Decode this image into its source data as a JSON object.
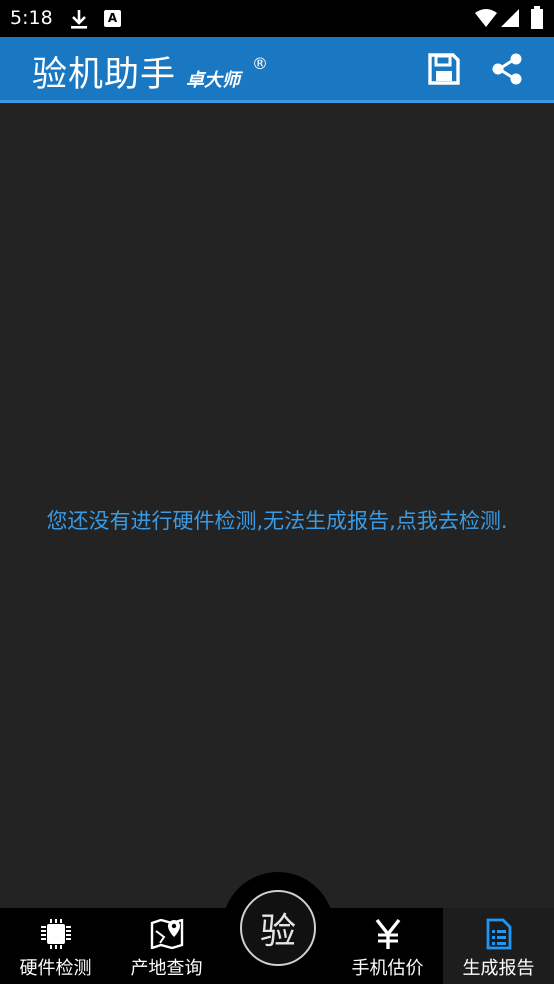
{
  "status_bar": {
    "time": "5:18",
    "download_icon": "download-icon",
    "notification_badge": "A"
  },
  "app_bar": {
    "title": "验机助手",
    "subtitle": "卓大师",
    "registered_mark": "®",
    "save_icon": "save-icon",
    "share_icon": "share-icon",
    "color": "#1a78c2"
  },
  "main": {
    "empty_message": "您还没有进行硬件检测,无法生成报告,点我去检测.",
    "message_color": "#3a9be4"
  },
  "bottom_nav": {
    "items": [
      {
        "label": "硬件检测",
        "icon": "chip-icon",
        "active": false
      },
      {
        "label": "产地查询",
        "icon": "map-pin-icon",
        "active": false
      },
      {
        "label": "手机估价",
        "icon": "yen-icon",
        "active": false
      },
      {
        "label": "生成报告",
        "icon": "report-icon",
        "active": true
      }
    ],
    "center_button": {
      "label": "验"
    },
    "active_color": "#2196f3"
  }
}
